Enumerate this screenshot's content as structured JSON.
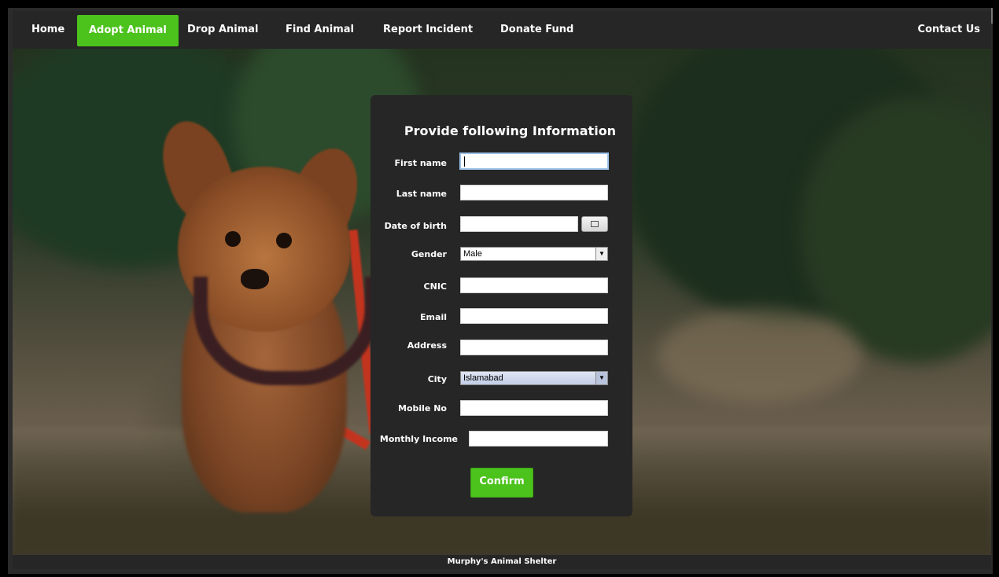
{
  "nav": {
    "items": [
      "Home",
      "Adopt Animal",
      "Drop Animal",
      "Find Animal",
      "Report Incident",
      "Donate Fund"
    ],
    "contact": "Contact Us",
    "active_color": "#4cc21c"
  },
  "form": {
    "title": "Provide following Information",
    "labels": {
      "first_name": "First name",
      "last_name": "Last name",
      "dob": "Date of birth",
      "gender": "Gender",
      "cnic": "CNIC",
      "email": "Email",
      "address": "Address",
      "city": "City",
      "mobile": "Mobile No",
      "income": "Monthly Income"
    },
    "values": {
      "first_name": "",
      "last_name": "",
      "dob": "",
      "cnic": "",
      "email": "",
      "address": "",
      "mobile": "",
      "income": ""
    },
    "gender_selected": "Male",
    "city_selected": "Islamabad",
    "calendar_icon": "calendar-icon",
    "confirm_label": "Confirm"
  },
  "footer": {
    "text": "Murphy's Animal Shelter"
  }
}
